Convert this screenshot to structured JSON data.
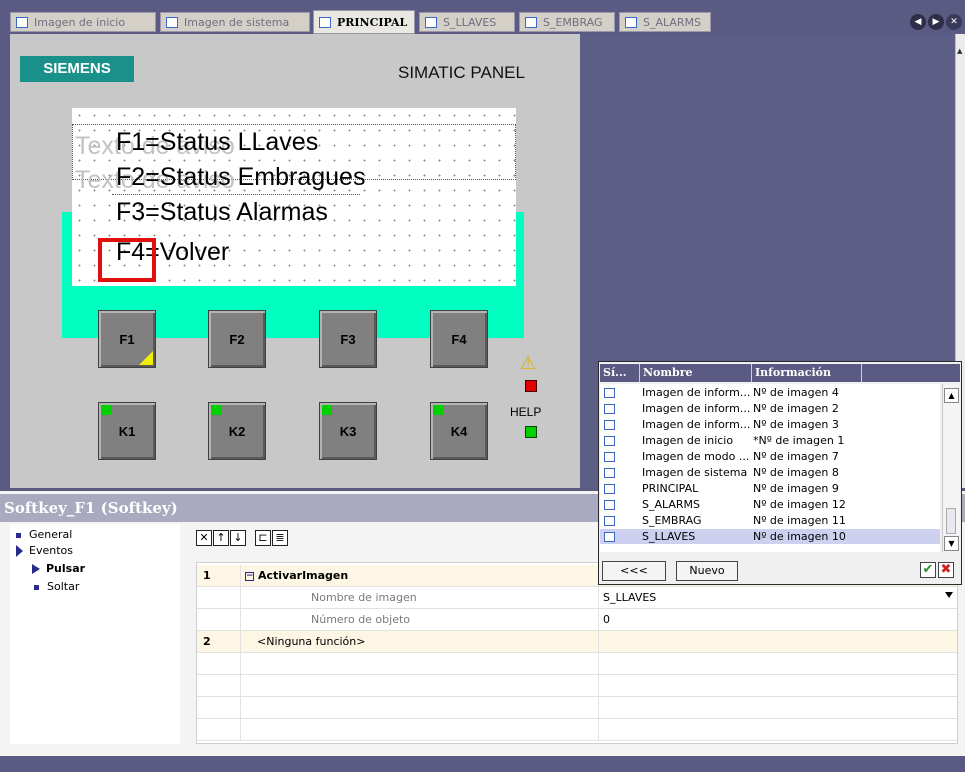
{
  "tabs": [
    {
      "label": "Imagen de inicio",
      "active": false
    },
    {
      "label": "Imagen de sistema",
      "active": false
    },
    {
      "label": "PRINCIPAL",
      "active": true
    },
    {
      "label": "S_LLAVES",
      "active": false
    },
    {
      "label": "S_EMBRAG",
      "active": false
    },
    {
      "label": "S_ALARMS",
      "active": false
    }
  ],
  "nav": {
    "prev": "◀",
    "next": "▶",
    "close": "✕"
  },
  "panel": {
    "brand": "SIEMENS",
    "model": "SIMATIC PANEL",
    "screen_lines": [
      "F1=Status LLaves",
      "F2=Status Embragues",
      "F3=Status Alarmas",
      "F4=Volver"
    ],
    "ghost_text": [
      "Texto de aviso",
      "Texto de aviso"
    ],
    "fkeys": [
      "F1",
      "F2",
      "F3",
      "F4"
    ],
    "kkeys": [
      "K1",
      "K2",
      "K3",
      "K4"
    ],
    "help_label": "HELP",
    "warning_glyph": "⚠"
  },
  "properties": {
    "title": "Softkey_F1 (Softkey)",
    "tree": {
      "general": "General",
      "eventos": "Eventos",
      "pulsar": "Pulsar",
      "soltar": "Soltar"
    },
    "toolbar": [
      "✕",
      "↑",
      "↓",
      "⊏",
      "≣"
    ],
    "rows": [
      {
        "num": "1",
        "label": "ActivarImagen",
        "value": ""
      },
      {
        "num": "",
        "label": "Nombre de imagen",
        "value": "S_LLAVES"
      },
      {
        "num": "",
        "label": "Número de objeto",
        "value": "0"
      },
      {
        "num": "2",
        "label": "<Ninguna función>",
        "value": ""
      }
    ]
  },
  "popup": {
    "headers": [
      "Sí...",
      "Nombre",
      "Información",
      ""
    ],
    "rows": [
      {
        "name": "Imagen de inform...",
        "info": "Nº de imagen 4",
        "selected": false
      },
      {
        "name": "Imagen de inform...",
        "info": "Nº de imagen 2",
        "selected": false
      },
      {
        "name": "Imagen de inform...",
        "info": "Nº de imagen 3",
        "selected": false
      },
      {
        "name": "Imagen de inicio",
        "info": "*Nº de imagen 1",
        "selected": false
      },
      {
        "name": "Imagen de modo ...",
        "info": "Nº de imagen 7",
        "selected": false
      },
      {
        "name": "Imagen de sistema",
        "info": "Nº de imagen 8",
        "selected": false
      },
      {
        "name": "PRINCIPAL",
        "info": "Nº de imagen 9",
        "selected": false
      },
      {
        "name": "S_ALARMS",
        "info": "Nº de imagen 12",
        "selected": false
      },
      {
        "name": "S_EMBRAG",
        "info": "Nº de imagen 11",
        "selected": false
      },
      {
        "name": "S_LLAVES",
        "info": "Nº de imagen 10",
        "selected": true
      }
    ],
    "back_button": "<<<",
    "new_button": "Nuevo",
    "ok_glyph": "✔",
    "cancel_glyph": "✖"
  },
  "colors": {
    "accent": "#5a5a82",
    "brand": "#1a908a",
    "screen_bg": "#00ffc0",
    "highlight": "#e01010"
  }
}
